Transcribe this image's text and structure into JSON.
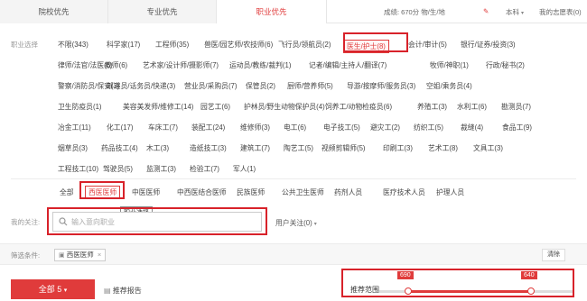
{
  "tabs": [
    {
      "label": "院校优先",
      "active": false
    },
    {
      "label": "专业优先",
      "active": false
    },
    {
      "label": "职业优先",
      "active": true
    }
  ],
  "header": {
    "score": "成绩: 670分 物/生/地",
    "edit_icon": "edit-icon",
    "level": "本科",
    "my_form": "我的志愿表(0)"
  },
  "career": {
    "label": "职业选择",
    "rows": [
      [
        "不限(343)",
        "科学家(17)",
        "工程师(35)",
        "兽医/园艺师/农技师(6)",
        "飞行员/领航员(2)",
        "医生/护士(8)",
        "会计/审计(5)",
        "银行/证券/投资(3)"
      ],
      [
        "律师/法官/法医(6)",
        "教师(6)",
        "艺术家/设计师/摄影师(7)",
        "运动员/教练/裁判(1)",
        "记者/编辑/主持人/翻译(7)",
        "牧师/神职(1)",
        "行政/秘书(2)"
      ],
      [
        "警察/消防员/保安(3)",
        "邮递员/话务员/快递(3)",
        "营业员/采购员(7)",
        "保管员(2)",
        "厨师/营养师(5)",
        "导游/按摩师/服务员(3)",
        "空姐/乘务员(4)"
      ],
      [
        "卫生防疫员(1)",
        "美容美发师/维修工(14)",
        "园艺工(6)",
        "护林员/野生动物保护员(4)",
        "饲养工/动物检疫员(6)",
        "养殖工(3)",
        "水利工(6)",
        "勘测员(7)"
      ],
      [
        "冶金工(11)",
        "化工(17)",
        "车床工(7)",
        "装配工(24)",
        "维修师(3)",
        "电工(6)",
        "电子技工(5)",
        "避灾工(2)",
        "纺织工(5)",
        "裁缝(4)",
        "食品工(9)"
      ],
      [
        "烟草员(3)",
        "药品技工(4)",
        "木工(3)",
        "造纸技工(3)",
        "建筑工(7)",
        "陶艺工(5)",
        "视频剪辑师(5)",
        "印刷工(3)",
        "艺术工(8)",
        "文具工(3)"
      ],
      [
        "工程技工(10)",
        "驾驶员(5)",
        "监测工(3)",
        "检验工(7)",
        "军人(1)"
      ]
    ]
  },
  "sub_options": [
    "全部",
    "西医医师",
    "中医医师",
    "中西医结合医师",
    "民族医师",
    "公共卫生医师",
    "药剂人员",
    "医疗技术人员",
    "护理人员"
  ],
  "tooltip": "职业选择",
  "my_focus": {
    "label": "我的关注:",
    "placeholder": "输入意向职业"
  },
  "user_focus": "用户关注(0)",
  "screen": {
    "label": "筛选条件:",
    "chip": "西医医师",
    "clear": "清除"
  },
  "bottom": {
    "all_button": "全部 5",
    "report": "推荐报告",
    "range_label": "推荐范围",
    "range_low": 690,
    "range_high": 640
  },
  "colors": {
    "accent": "#e03b3b",
    "highlight": "#d8222a"
  }
}
